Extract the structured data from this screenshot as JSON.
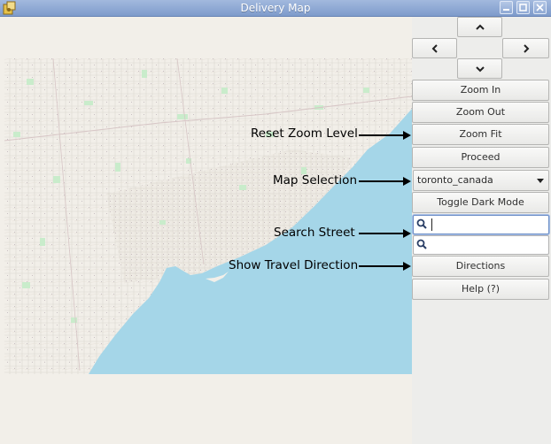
{
  "window": {
    "title": "Delivery Map"
  },
  "controls": {
    "pan_up": "up-chevron",
    "pan_left": "left-chevron",
    "pan_right": "right-chevron",
    "pan_down": "down-chevron",
    "zoom_in": "Zoom In",
    "zoom_out": "Zoom Out",
    "zoom_fit": "Zoom Fit",
    "proceed": "Proceed",
    "map_selection_value": "toronto_canada",
    "toggle_dark_mode": "Toggle Dark Mode",
    "search_street_1_value": "",
    "search_street_2_value": "",
    "directions": "Directions",
    "help": "Help (?)"
  },
  "annotations": {
    "reset_zoom": "Reset Zoom Level",
    "map_selection": "Map Selection",
    "search_street": "Search Street",
    "show_travel_direction": "Show Travel Direction"
  },
  "colors": {
    "land": "#f2efe9",
    "water": "#a5d6e8",
    "park": "#c9eccb",
    "accent": "#7e9bcb"
  }
}
